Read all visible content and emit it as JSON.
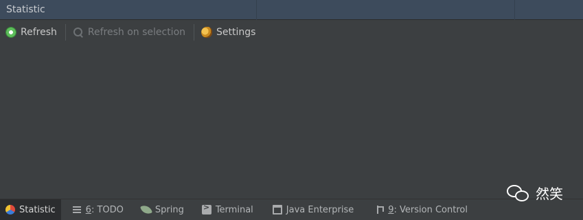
{
  "panel": {
    "title": "Statistic"
  },
  "toolbar": {
    "refresh_label": "Refresh",
    "refresh_selection_label": "Refresh on selection",
    "settings_label": "Settings"
  },
  "statusbar": {
    "tabs": [
      {
        "label": "Statistic",
        "icon": "statistic-icon",
        "active": true
      },
      {
        "shortcut": "6",
        "label": ": TODO",
        "icon": "todo-list-icon"
      },
      {
        "label": "Spring",
        "icon": "spring-leaf-icon"
      },
      {
        "label": "Terminal",
        "icon": "terminal-icon"
      },
      {
        "label": "Java Enterprise",
        "icon": "java-enterprise-icon"
      },
      {
        "shortcut": "9",
        "label": ": Version Control",
        "icon": "version-control-icon"
      }
    ]
  },
  "watermark": {
    "text": "然笑"
  },
  "colors": {
    "background": "#3c3f41",
    "titlebar": "#3d4b5c",
    "active_tab": "#2b2d2f"
  }
}
